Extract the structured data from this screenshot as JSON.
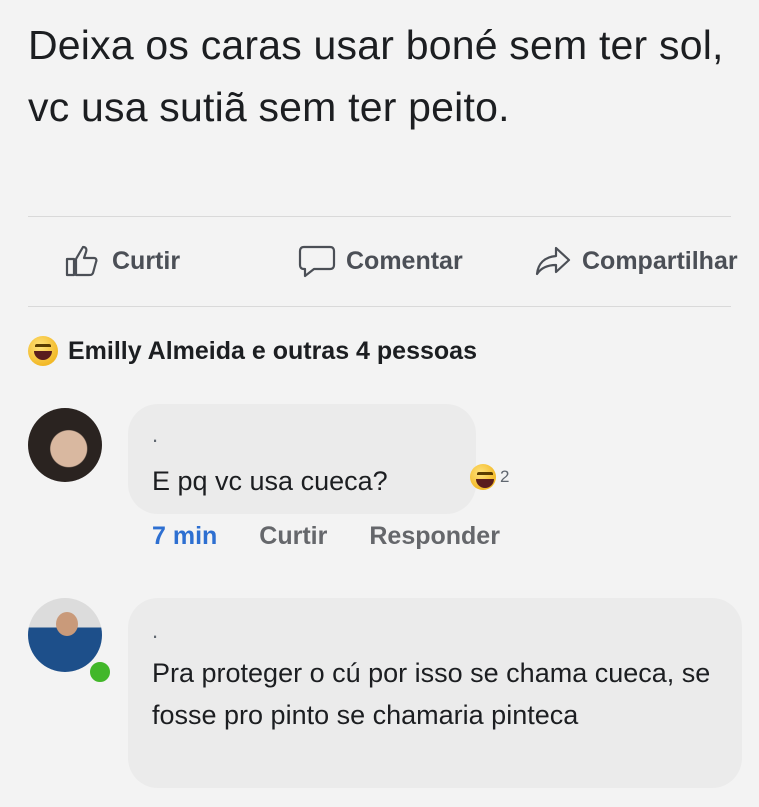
{
  "post": {
    "text": "Deixa os caras usar boné sem ter sol, vc usa sutiã sem ter peito."
  },
  "actions": {
    "like": "Curtir",
    "comment": "Comentar",
    "share": "Compartilhar"
  },
  "reactions_summary": {
    "emoji": "haha-emoji-icon",
    "text": "Emilly Almeida e outras 4 pessoas"
  },
  "comments": [
    {
      "prefix": ".",
      "text": "E pq vc usa cueca?",
      "reaction_count": "2",
      "time": "7 min",
      "like_label": "Curtir",
      "reply_label": "Responder"
    },
    {
      "prefix": ".",
      "text": "Pra proteger o cú por isso se chama cueca, se fosse pro pinto se chamaria pinteca",
      "online": true
    }
  ],
  "colors": {
    "background": "#f3f3f3",
    "bubble": "#ebebeb",
    "time_blue": "#2d6fd1",
    "online_green": "#42b72a"
  }
}
